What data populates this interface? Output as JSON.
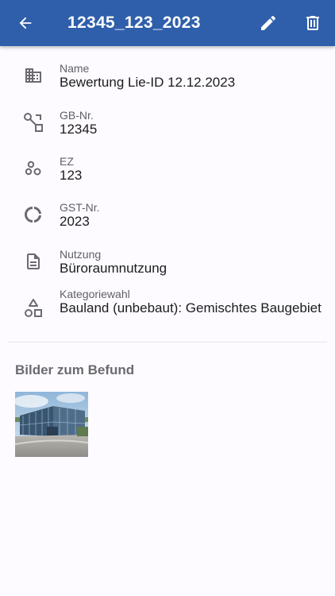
{
  "appbar": {
    "title": "12345_123_2023",
    "back_icon": "arrow-back-icon",
    "edit_icon": "pencil-icon",
    "delete_icon": "trash-icon",
    "color": "#2f5fab"
  },
  "fields": [
    {
      "icon": "building-icon",
      "label": "Name",
      "value": "Bewertung Lie-ID 12.12.2023"
    },
    {
      "icon": "route-icon",
      "label": "GB-Nr.",
      "value": "12345"
    },
    {
      "icon": "bubbles-icon",
      "label": "EZ",
      "value": "123"
    },
    {
      "icon": "donut-icon",
      "label": "GST-Nr.",
      "value": "2023"
    },
    {
      "icon": "document-icon",
      "label": "Nutzung",
      "value": "Büroraumnutzung"
    },
    {
      "icon": "shapes-icon",
      "label": "Kategoriewahl",
      "value": "Bauland (unbebaut): Gemischtes Baugebiet"
    }
  ],
  "images_section": {
    "title": "Bilder zum Befund",
    "images": [
      {
        "description": "building-photo"
      }
    ]
  }
}
